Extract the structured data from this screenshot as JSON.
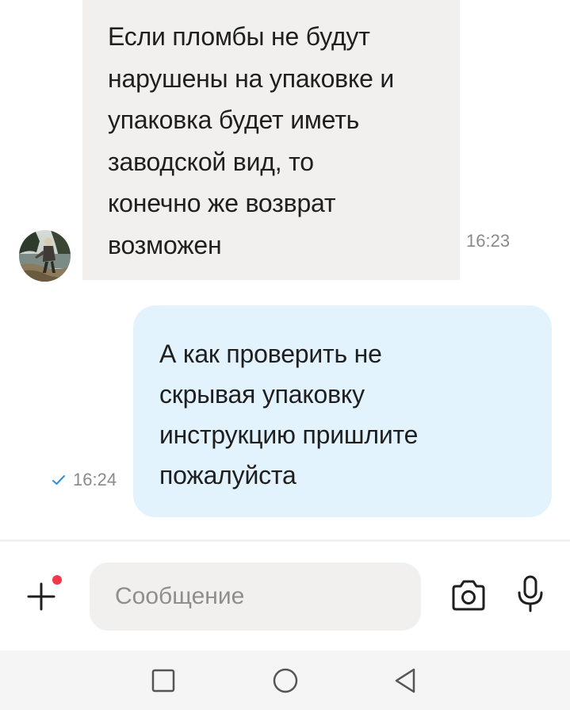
{
  "messages": {
    "incoming": {
      "text": "Если пломбы не будут\nнарушены на упаковке и\nупаковка будет иметь\nзаводской вид, то\nконечно же возврат\nвозможен",
      "time": "16:23"
    },
    "outgoing": {
      "text": "А как проверить не\nскрывая упаковку\nинструкцию пришлите\nпожалуйста",
      "time": "16:24",
      "status_icon": "check-icon"
    }
  },
  "composer": {
    "placeholder": "Сообщение",
    "value": "",
    "attach_icon": "plus-icon",
    "camera_icon": "camera-icon",
    "mic_icon": "microphone-icon",
    "has_notification_dot": true
  },
  "navbar": {
    "icons": [
      "square-icon",
      "circle-icon",
      "triangle-back-icon"
    ]
  },
  "colors": {
    "incoming_bubble": "#f1f0ef",
    "outgoing_bubble": "#e3f3fd",
    "check": "#2d8fd8",
    "notify_dot": "#f2394a"
  }
}
